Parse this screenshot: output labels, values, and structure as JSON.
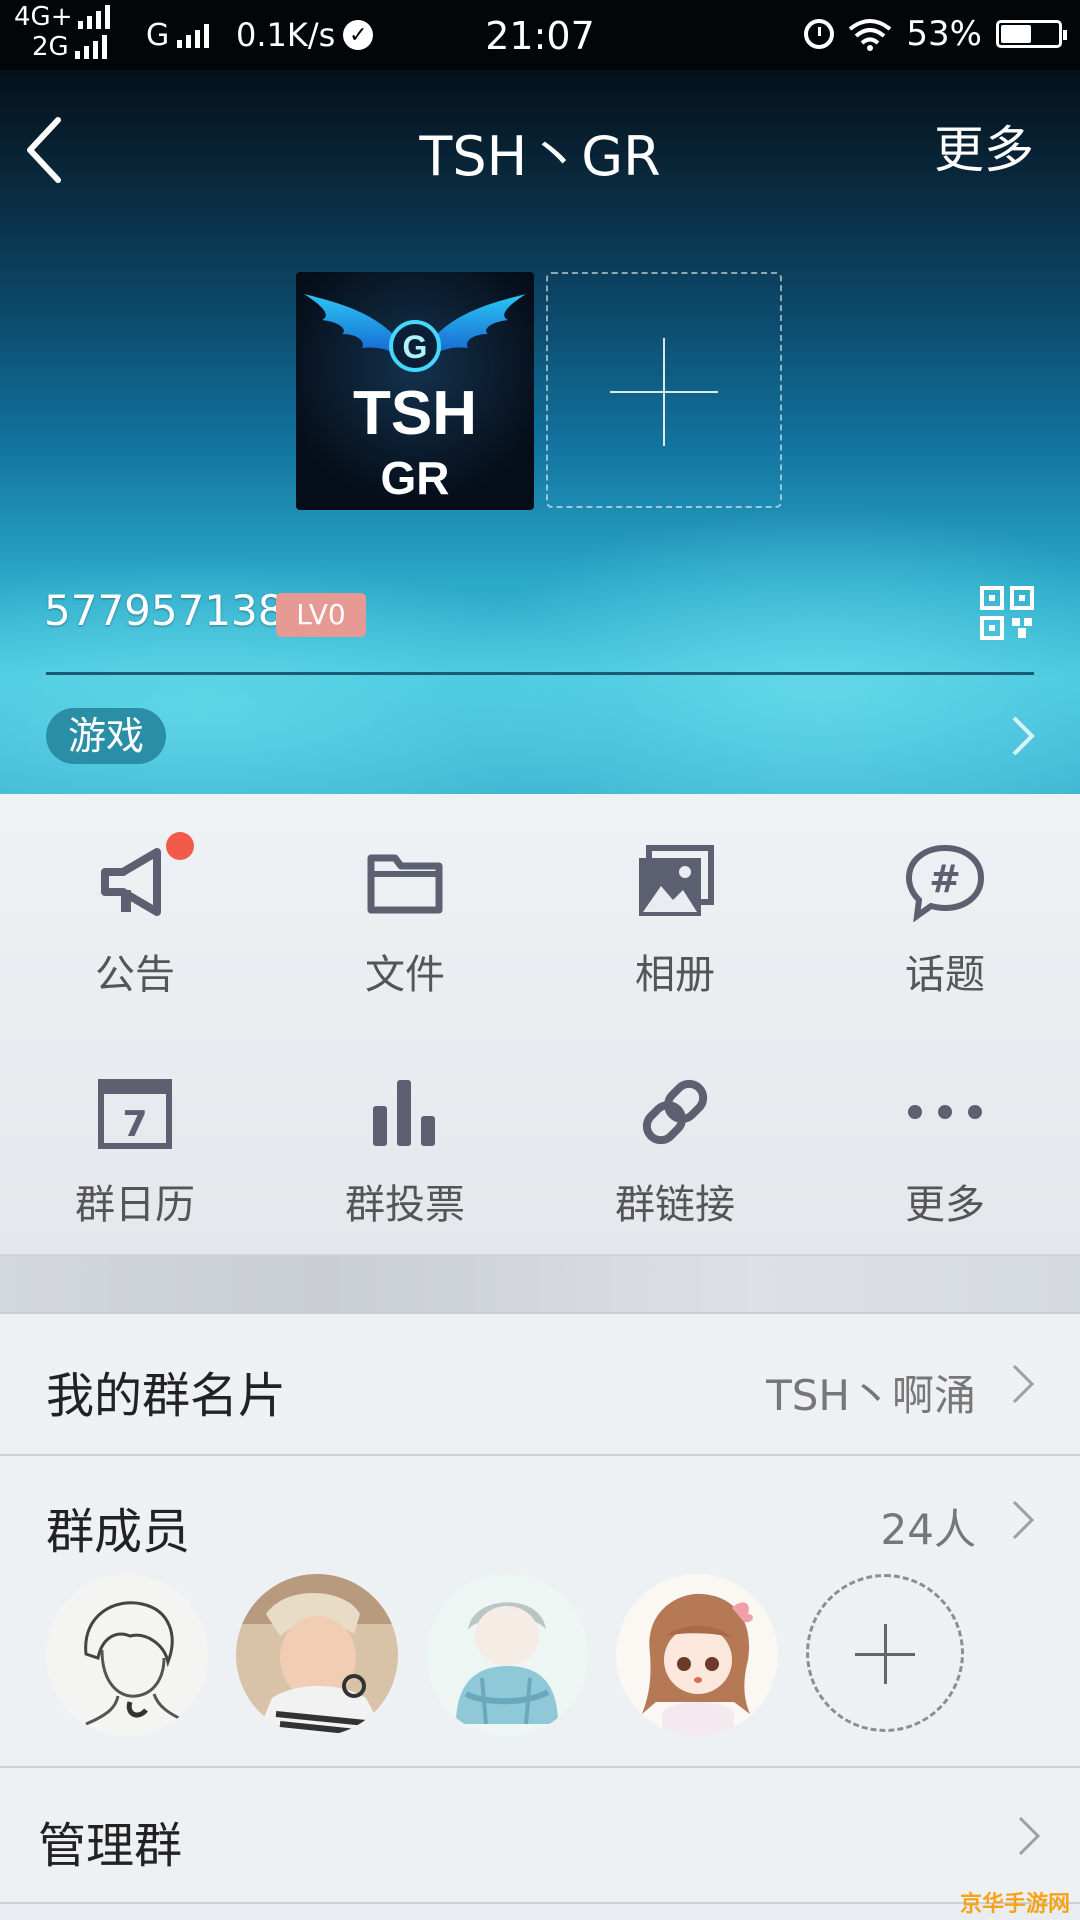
{
  "status_bar": {
    "net_top": "4G+",
    "net_bottom": "2G",
    "net_g": "G",
    "speed": "0.1K/s",
    "time": "21:07",
    "battery": "53%",
    "battery_level": 0.53
  },
  "nav": {
    "title": "TSH丶GR",
    "more": "更多"
  },
  "group": {
    "logo_text_top": "TSH",
    "logo_text_bottom": "GR",
    "logo_letter": "G",
    "id": "577957138",
    "level": "LV0",
    "tag": "游戏"
  },
  "tools": [
    {
      "label": "公告",
      "icon": "megaphone-icon"
    },
    {
      "label": "文件",
      "icon": "folder-icon"
    },
    {
      "label": "相册",
      "icon": "album-icon"
    },
    {
      "label": "话题",
      "icon": "topic-icon"
    },
    {
      "label": "群日历",
      "icon": "calendar-icon",
      "day": "7"
    },
    {
      "label": "群投票",
      "icon": "poll-icon"
    },
    {
      "label": "群链接",
      "icon": "link-icon"
    },
    {
      "label": "更多",
      "icon": "more-icon"
    }
  ],
  "rows": {
    "card_title": "我的群名片",
    "card_value": "TSH丶啊涌",
    "members_title": "群成员",
    "members_count": "24人",
    "manage_title": "管理群"
  },
  "watermark": "京华手游网",
  "colors": {
    "badge": "#e79a93",
    "notify_dot": "#f25a4a",
    "icon_gray": "#5c6070"
  }
}
